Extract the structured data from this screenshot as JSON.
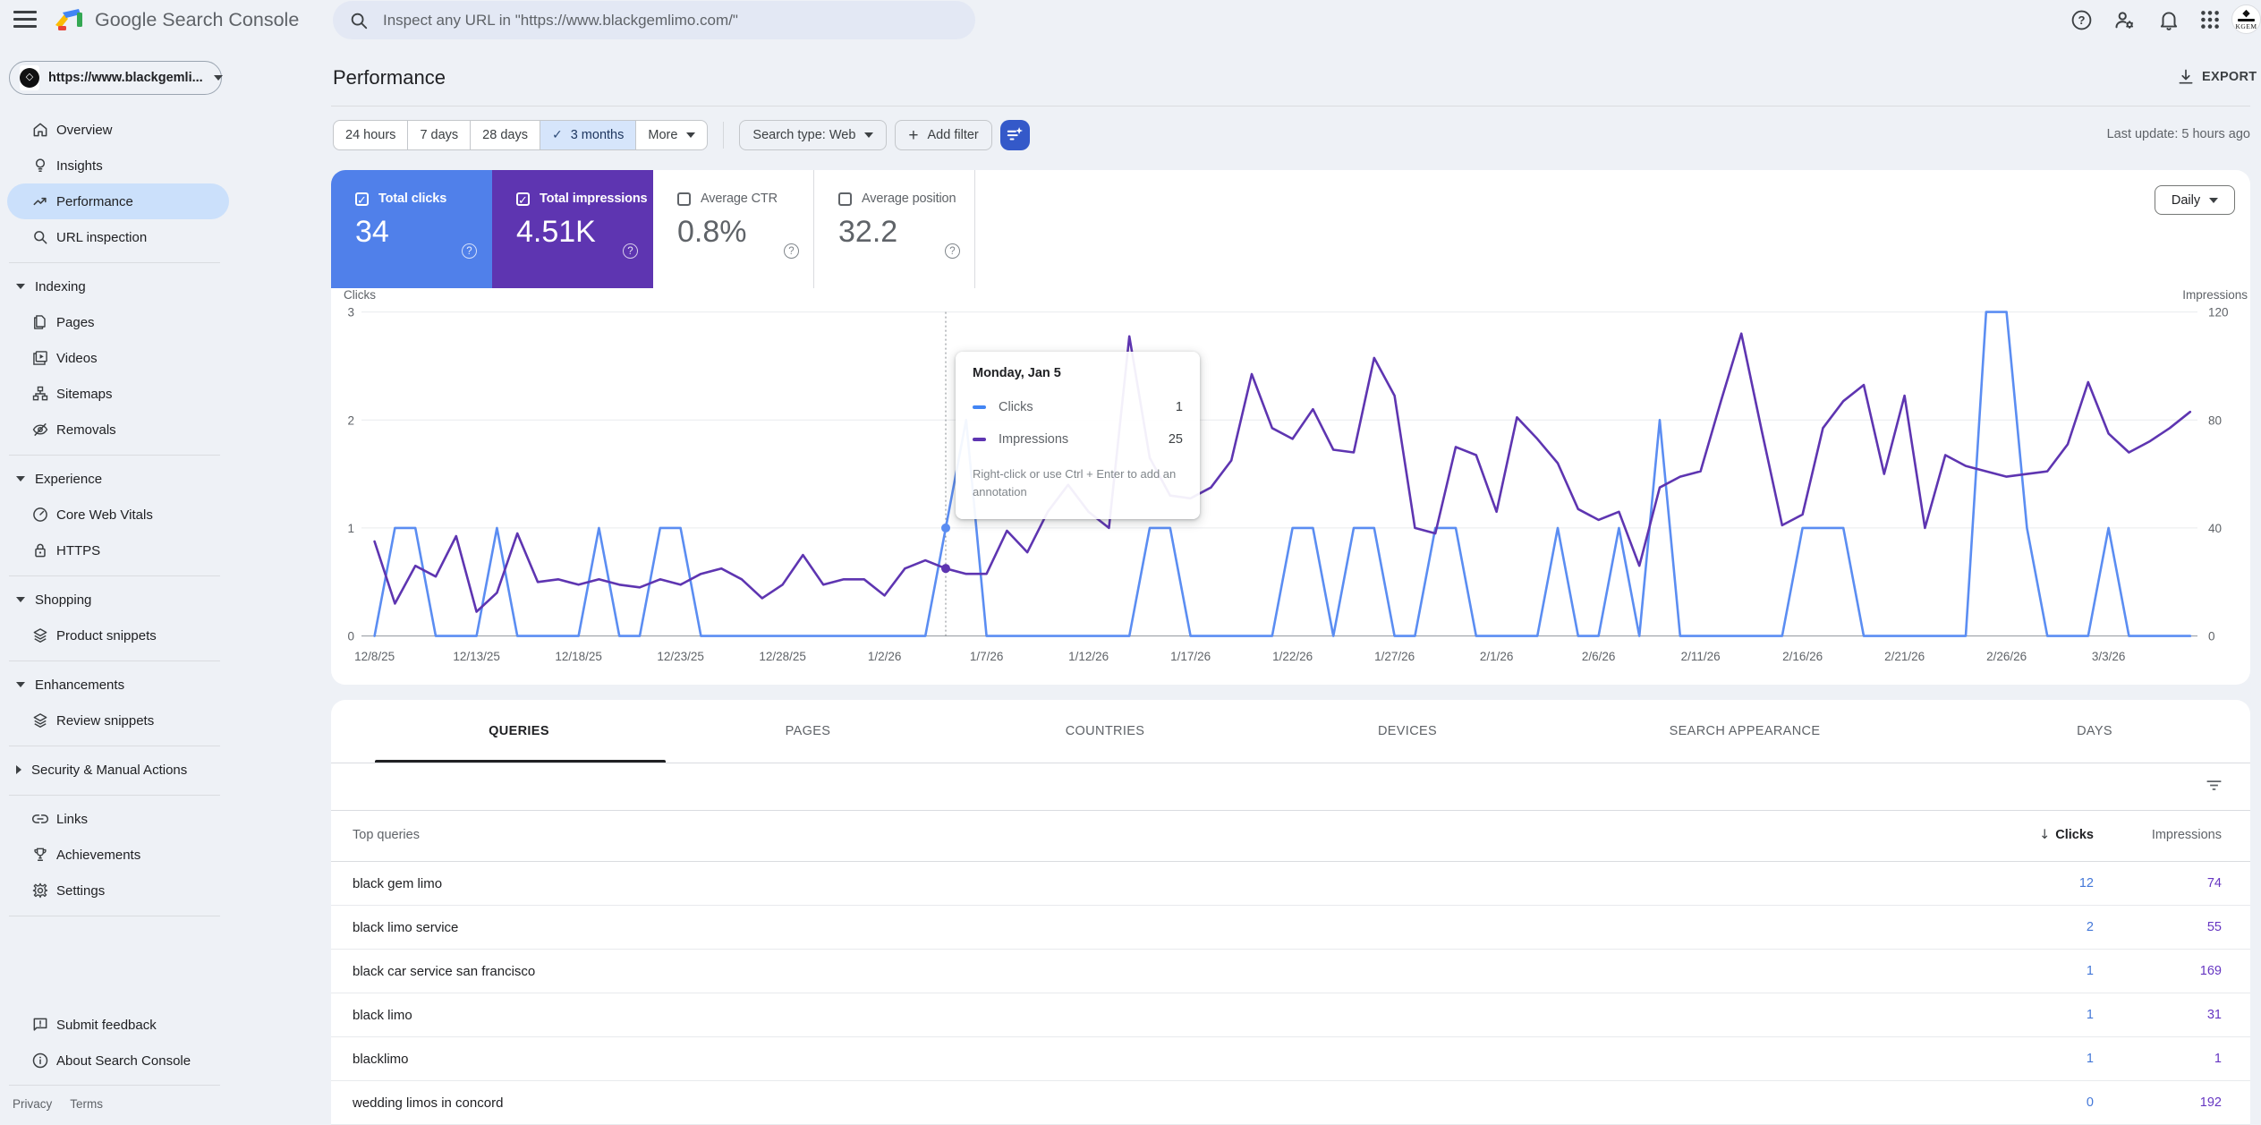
{
  "topbar": {
    "logo_text": "Google Search Console",
    "search_placeholder": "Inspect any URL in \"https://www.blackgemlimo.com/\"",
    "avatar_text": "KGEM"
  },
  "property": {
    "name": "https://www.blackgemli..."
  },
  "sidebar": {
    "items": [
      {
        "type": "item",
        "label": "Overview",
        "icon": "home"
      },
      {
        "type": "item",
        "label": "Insights",
        "icon": "insights"
      },
      {
        "type": "item",
        "label": "Performance",
        "icon": "performance",
        "selected": true
      },
      {
        "type": "item",
        "label": "URL inspection",
        "icon": "search"
      },
      {
        "type": "divider"
      },
      {
        "type": "section",
        "label": "Indexing",
        "expanded": true
      },
      {
        "type": "item",
        "label": "Pages",
        "icon": "pages"
      },
      {
        "type": "item",
        "label": "Videos",
        "icon": "videos"
      },
      {
        "type": "item",
        "label": "Sitemaps",
        "icon": "sitemaps"
      },
      {
        "type": "item",
        "label": "Removals",
        "icon": "removals"
      },
      {
        "type": "divider"
      },
      {
        "type": "section",
        "label": "Experience",
        "expanded": true
      },
      {
        "type": "item",
        "label": "Core Web Vitals",
        "icon": "gauge"
      },
      {
        "type": "item",
        "label": "HTTPS",
        "icon": "lock"
      },
      {
        "type": "divider"
      },
      {
        "type": "section",
        "label": "Shopping",
        "expanded": true
      },
      {
        "type": "item",
        "label": "Product snippets",
        "icon": "layers"
      },
      {
        "type": "divider"
      },
      {
        "type": "section",
        "label": "Enhancements",
        "expanded": true
      },
      {
        "type": "item",
        "label": "Review snippets",
        "icon": "layers"
      },
      {
        "type": "divider"
      },
      {
        "type": "section",
        "label": "Security & Manual Actions",
        "expanded": false
      },
      {
        "type": "divider"
      },
      {
        "type": "item",
        "label": "Links",
        "icon": "link"
      },
      {
        "type": "item",
        "label": "Achievements",
        "icon": "trophy"
      },
      {
        "type": "item",
        "label": "Settings",
        "icon": "gear"
      },
      {
        "type": "divider"
      }
    ],
    "footer_items": [
      {
        "label": "Submit feedback",
        "icon": "feedback"
      },
      {
        "label": "About Search Console",
        "icon": "info"
      }
    ],
    "legal": [
      "Privacy",
      "Terms"
    ]
  },
  "page": {
    "title": "Performance",
    "export_label": "EXPORT",
    "last_update": "Last update: 5 hours ago"
  },
  "filters": {
    "date_chips": [
      "24 hours",
      "7 days",
      "28 days",
      "3 months",
      "More"
    ],
    "selected_chip": "3 months",
    "search_type_label": "Search type: Web",
    "add_filter_label": "Add filter"
  },
  "metrics": [
    {
      "label": "Total clicks",
      "value": "34",
      "checked": true,
      "color": "#5080ea"
    },
    {
      "label": "Total impressions",
      "value": "4.51K",
      "checked": true,
      "color": "#5e35b1"
    },
    {
      "label": "Average CTR",
      "value": "0.8%",
      "checked": false,
      "color": "#ffffff"
    },
    {
      "label": "Average position",
      "value": "32.2",
      "checked": false,
      "color": "#ffffff"
    }
  ],
  "chart_controls": {
    "granularity": "Daily"
  },
  "chart_data": {
    "type": "line",
    "x_tick_labels": [
      "12/8/25",
      "12/13/25",
      "12/18/25",
      "12/23/25",
      "12/28/25",
      "1/2/26",
      "1/7/26",
      "1/12/26",
      "1/17/26",
      "1/22/26",
      "1/27/26",
      "2/1/26",
      "2/6/26",
      "2/11/26",
      "2/16/26",
      "2/21/26",
      "2/26/26",
      "3/3/26"
    ],
    "x_tick_step": 5,
    "left_axis": {
      "label": "Clicks",
      "ticks": [
        0,
        1,
        2,
        3
      ],
      "max": 3
    },
    "right_axis": {
      "label": "Impressions",
      "ticks": [
        0,
        40,
        80,
        120
      ],
      "max": 120
    },
    "grid": true,
    "legend_position": "none",
    "series": [
      {
        "name": "Clicks",
        "axis": "left",
        "color": "#5b8df2",
        "values": [
          0,
          1,
          1,
          0,
          0,
          0,
          1,
          0,
          0,
          0,
          0,
          1,
          0,
          0,
          1,
          1,
          0,
          0,
          0,
          0,
          0,
          0,
          0,
          0,
          0,
          0,
          0,
          0,
          1,
          2,
          0,
          0,
          0,
          0,
          0,
          0,
          0,
          0,
          1,
          1,
          0,
          0,
          0,
          0,
          0,
          1,
          1,
          0,
          1,
          1,
          0,
          0,
          1,
          1,
          0,
          0,
          0,
          0,
          1,
          0,
          0,
          1,
          0,
          2,
          0,
          0,
          0,
          0,
          0,
          0,
          1,
          1,
          1,
          0,
          0,
          0,
          0,
          0,
          0,
          3,
          3,
          1,
          0,
          0,
          0,
          1,
          0,
          0,
          0,
          0
        ]
      },
      {
        "name": "Impressions",
        "axis": "right",
        "color": "#5e35b1",
        "values": [
          35,
          12,
          26,
          22,
          37,
          9,
          16,
          38,
          20,
          21,
          19,
          21,
          19,
          18,
          21,
          19,
          23,
          25,
          21,
          14,
          19,
          30,
          19,
          21,
          21,
          15,
          25,
          28,
          25,
          23,
          23,
          39,
          31,
          46,
          56,
          46,
          40,
          111,
          66,
          52,
          51,
          55,
          65,
          97,
          77,
          73,
          84,
          69,
          68,
          103,
          89,
          40,
          38,
          70,
          67,
          46,
          81,
          73,
          64,
          47,
          43,
          46,
          26,
          55,
          59,
          61,
          87,
          112,
          76,
          41,
          45,
          77,
          87,
          93,
          60,
          89,
          40,
          67,
          63,
          61,
          59,
          60,
          61,
          71,
          94,
          75,
          68,
          72,
          77,
          83
        ]
      }
    ]
  },
  "tooltip": {
    "title": "Monday, Jan 5",
    "day_index": 28,
    "rows": [
      {
        "label": "Clicks",
        "value": "1",
        "color": "#4285f4"
      },
      {
        "label": "Impressions",
        "value": "25",
        "color": "#5e35b1"
      }
    ],
    "hint": "Right-click or use Ctrl + Enter to add an annotation"
  },
  "table": {
    "tabs": [
      "QUERIES",
      "PAGES",
      "COUNTRIES",
      "DEVICES",
      "SEARCH APPEARANCE",
      "DAYS"
    ],
    "active_tab": "QUERIES",
    "tab_centers": [
      210,
      533,
      865,
      1203,
      1580,
      1971
    ],
    "columns": {
      "rows_header": "Top queries",
      "clicks": "Clicks",
      "impressions": "Impressions"
    },
    "sort_icon": "arrow-down",
    "rows": [
      {
        "query": "black gem limo",
        "clicks": "12",
        "impressions": "74"
      },
      {
        "query": "black limo service",
        "clicks": "2",
        "impressions": "55"
      },
      {
        "query": "black car service san francisco",
        "clicks": "1",
        "impressions": "169"
      },
      {
        "query": "black limo",
        "clicks": "1",
        "impressions": "31"
      },
      {
        "query": "blacklimo",
        "clicks": "1",
        "impressions": "1"
      },
      {
        "query": "wedding limos in concord",
        "clicks": "0",
        "impressions": "192"
      }
    ]
  }
}
